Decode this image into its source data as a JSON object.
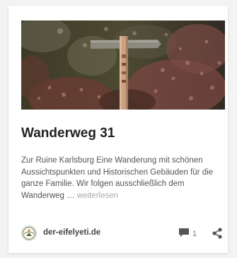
{
  "post": {
    "image_alt": "Wooden signpost in the forest",
    "title": "Wanderweg 31",
    "excerpt": "Zur Ruine Karlsburg Eine Wanderung mit schönen Aussichtspunkten und Historischen Gebäuden für die ganze Familie. Wir folgen ausschließlich dem Wanderweg …",
    "read_more": "weiterlesen",
    "author": "der-eifelyeti.de",
    "comment_count": "1"
  },
  "icons": {
    "comment": "comment-icon",
    "share": "share-icon",
    "avatar": "yeti-logo-icon"
  },
  "colors": {
    "title": "#222222",
    "text": "#555555",
    "read_more": "#a9a9a9",
    "icon": "#555555"
  }
}
